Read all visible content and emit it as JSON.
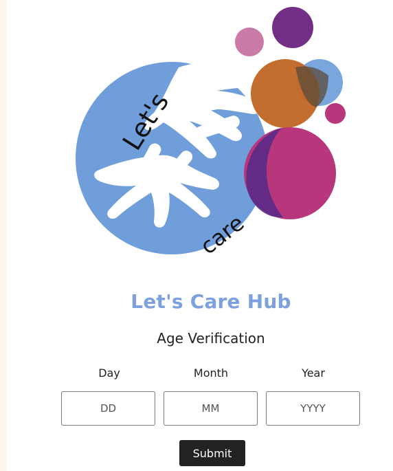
{
  "app": {
    "title": "Let's Care Hub",
    "subtitle": "Age Verification"
  },
  "logo": {
    "text_top": "Let's",
    "text_bottom": "care"
  },
  "form": {
    "day": {
      "label": "Day",
      "placeholder": "DD"
    },
    "month": {
      "label": "Month",
      "placeholder": "MM"
    },
    "year": {
      "label": "Year",
      "placeholder": "YYYY"
    },
    "submit_label": "Submit"
  },
  "colors": {
    "background": "#fdf6ea",
    "title_blue": "#7da1de",
    "logo_blue": "#6f9edb",
    "orange": "#c26a2a",
    "magenta": "#b8367c",
    "purple": "#732e86",
    "pink": "#c97aa7",
    "button": "#222222"
  }
}
